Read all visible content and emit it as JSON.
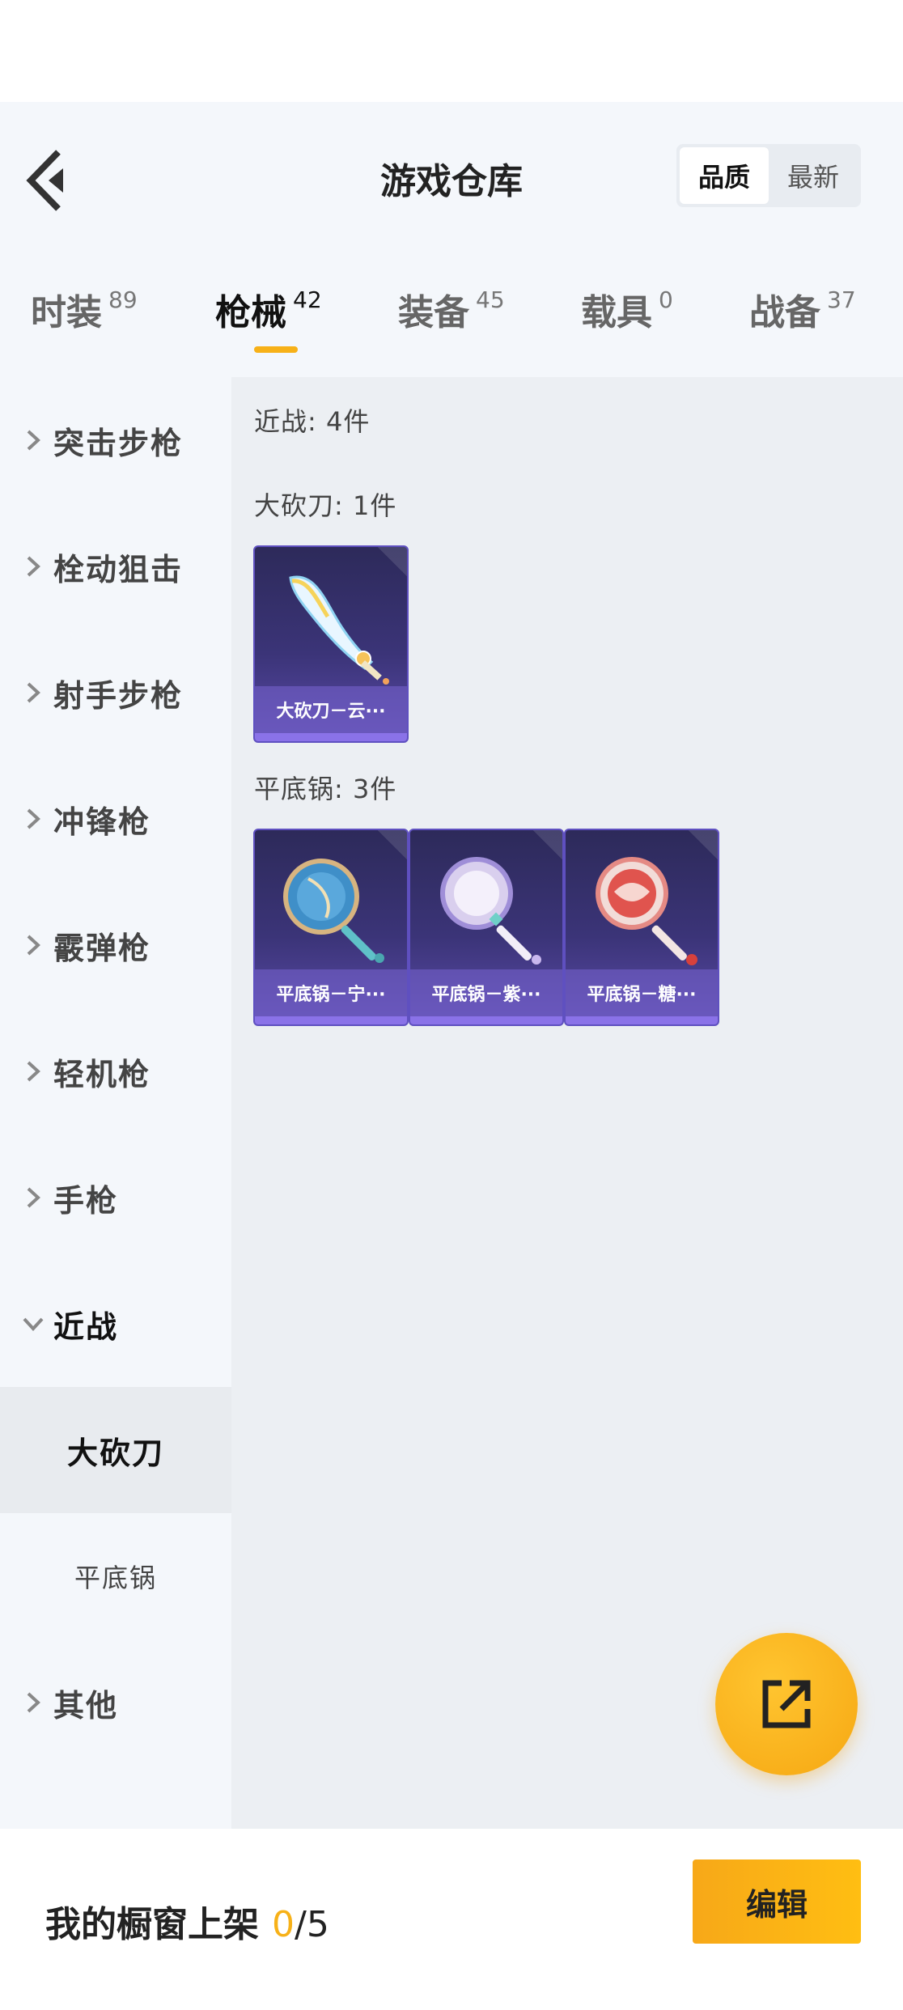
{
  "header": {
    "title": "游戏仓库",
    "sort_options": [
      {
        "label": "品质",
        "active": true
      },
      {
        "label": "最新",
        "active": false
      }
    ]
  },
  "tabs": [
    {
      "label": "时装",
      "count": "89",
      "active": false
    },
    {
      "label": "枪械",
      "count": "42",
      "active": true
    },
    {
      "label": "装备",
      "count": "45",
      "active": false
    },
    {
      "label": "载具",
      "count": "0",
      "active": false
    },
    {
      "label": "战备",
      "count": "37",
      "active": false
    }
  ],
  "sidebar": {
    "items": [
      {
        "label": "突击步枪"
      },
      {
        "label": "栓动狙击"
      },
      {
        "label": "射手步枪"
      },
      {
        "label": "冲锋枪"
      },
      {
        "label": "霰弹枪"
      },
      {
        "label": "轻机枪"
      },
      {
        "label": "手枪"
      },
      {
        "label": "近战"
      }
    ],
    "subitems": [
      {
        "label": "大砍刀",
        "selected": true
      },
      {
        "label": "平底锅",
        "selected": false
      }
    ],
    "last_item": {
      "label": "其他"
    }
  },
  "content": {
    "category_label": "近战: 4件",
    "groups": [
      {
        "label": "大砍刀: 1件",
        "items": [
          {
            "name": "大砍刀－云···",
            "art": "machete-icon"
          }
        ]
      },
      {
        "label": "平底锅: 3件",
        "items": [
          {
            "name": "平底锅－宁···",
            "art": "pan-blue-icon"
          },
          {
            "name": "平底锅－紫···",
            "art": "pan-purple-icon"
          },
          {
            "name": "平底锅－糖···",
            "art": "pan-red-icon"
          }
        ]
      }
    ]
  },
  "fab": {
    "icon": "share-external-icon"
  },
  "bottom_bar": {
    "shelf_label": "我的橱窗上架",
    "shelf_current": "0",
    "shelf_separator": "/",
    "shelf_max": "5",
    "edit_label": "编辑"
  },
  "colors": {
    "accent": "#f7b118",
    "card_bg": "#3b3478",
    "card_border": "#5f50c0",
    "panel_bg": "#eceff3",
    "sidebar_bg": "#f4f7fb"
  }
}
